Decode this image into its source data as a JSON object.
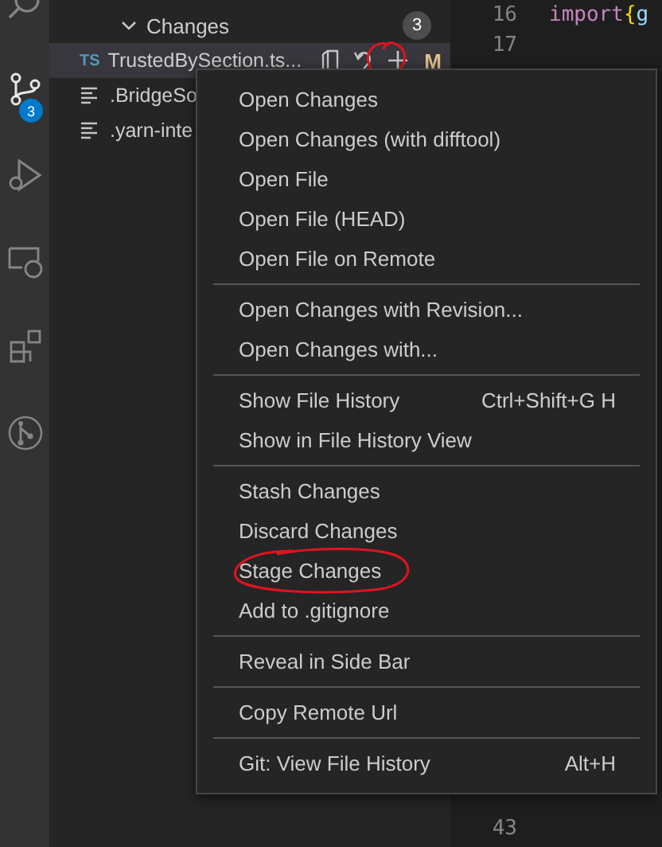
{
  "activity_bar": {
    "badge": "3"
  },
  "scm": {
    "section": "Changes",
    "count": "3",
    "expanded": true,
    "files": [
      {
        "kind": "ts",
        "badge": "TS",
        "name": "TrustedBySection.ts...",
        "status": "M",
        "selected": true
      },
      {
        "kind": "text",
        "name": ".BridgeSo",
        "selected": false
      },
      {
        "kind": "text",
        "name": ".yarn-inte",
        "selected": false
      }
    ]
  },
  "editor": {
    "top_lines": [
      {
        "number": "16",
        "tokens": [
          {
            "kind": "keyword",
            "text": "import"
          },
          {
            "kind": "bracket",
            "text": "{"
          },
          {
            "kind": "variable",
            "text": "g"
          }
        ]
      },
      {
        "number": "17"
      }
    ],
    "bottom_lines": [
      {
        "number": "43"
      }
    ]
  },
  "context_menu": {
    "groups": [
      [
        {
          "label": "Open Changes"
        },
        {
          "label": "Open Changes (with difftool)"
        },
        {
          "label": "Open File"
        },
        {
          "label": "Open File (HEAD)"
        },
        {
          "label": "Open File on Remote"
        }
      ],
      [
        {
          "label": "Open Changes with Revision..."
        },
        {
          "label": "Open Changes with..."
        }
      ],
      [
        {
          "label": "Show File History",
          "shortcut": "Ctrl+Shift+G H"
        },
        {
          "label": "Show in File History View"
        }
      ],
      [
        {
          "label": "Stash Changes"
        },
        {
          "label": "Discard Changes"
        },
        {
          "label": "Stage Changes"
        },
        {
          "label": "Add to .gitignore"
        }
      ],
      [
        {
          "label": "Reveal in Side Bar"
        }
      ],
      [
        {
          "label": "Copy Remote Url"
        }
      ],
      [
        {
          "label": "Git: View File History",
          "shortcut": "Alt+H"
        }
      ]
    ]
  }
}
